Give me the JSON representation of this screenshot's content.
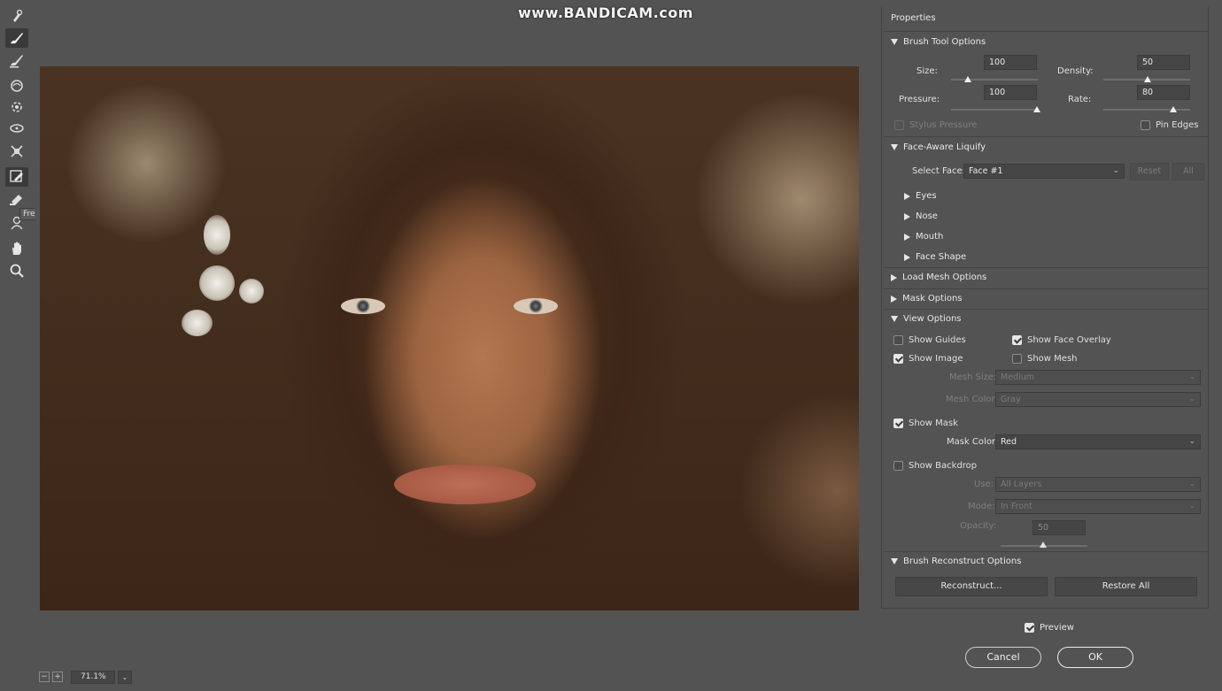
{
  "watermark": "www.BANDICAM.com",
  "tooltip": "Freeze Mask Tool (F)",
  "tools": [
    {
      "name": "face-tool-icon"
    },
    {
      "name": "forward-warp-tool-icon"
    },
    {
      "name": "reconstruct-tool-icon"
    },
    {
      "name": "smooth-tool-icon"
    },
    {
      "name": "twirl-clockwise-tool-icon"
    },
    {
      "name": "pucker-tool-icon"
    },
    {
      "name": "bloat-tool-icon"
    },
    {
      "name": "push-left-tool-icon"
    },
    {
      "name": "freeze-mask-tool-icon"
    },
    {
      "name": "thaw-mask-tool-icon"
    },
    {
      "name": "face-tool-icon"
    },
    {
      "name": "hand-tool-icon"
    },
    {
      "name": "zoom-tool-icon"
    }
  ],
  "status": {
    "zoom": "71.1%"
  },
  "panel": {
    "title": "Properties",
    "brush": {
      "heading": "Brush Tool Options",
      "size_label": "Size:",
      "size": "100",
      "density_label": "Density:",
      "density": "50",
      "pressure_label": "Pressure:",
      "pressure": "100",
      "rate_label": "Rate:",
      "rate": "80",
      "stylus_label": "Stylus Pressure",
      "pin_label": "Pin Edges"
    },
    "face_aware": {
      "heading": "Face-Aware Liquify",
      "select_face_label": "Select Face:",
      "select_face_value": "Face #1",
      "reset_label": "Reset",
      "all_label": "All",
      "subsections": [
        "Eyes",
        "Nose",
        "Mouth",
        "Face Shape"
      ]
    },
    "load_mesh": {
      "heading": "Load Mesh Options"
    },
    "mask_options": {
      "heading": "Mask Options"
    },
    "view": {
      "heading": "View Options",
      "show_guides": "Show Guides",
      "show_face_overlay": "Show Face Overlay",
      "show_image": "Show Image",
      "show_mesh": "Show Mesh",
      "mesh_size_label": "Mesh Size:",
      "mesh_size": "Medium",
      "mesh_color_label": "Mesh Color:",
      "mesh_color": "Gray",
      "show_mask": "Show Mask",
      "mask_color_label": "Mask Color:",
      "mask_color": "Red",
      "show_backdrop": "Show Backdrop",
      "use_label": "Use:",
      "use": "All Layers",
      "mode_label": "Mode:",
      "mode": "In Front",
      "opacity_label": "Opacity:",
      "opacity": "50"
    },
    "reconstruct": {
      "heading": "Brush Reconstruct Options",
      "reconstruct_label": "Reconstruct...",
      "restore_label": "Restore All"
    }
  },
  "dialog": {
    "preview_label": "Preview",
    "cancel_label": "Cancel",
    "ok_label": "OK"
  }
}
